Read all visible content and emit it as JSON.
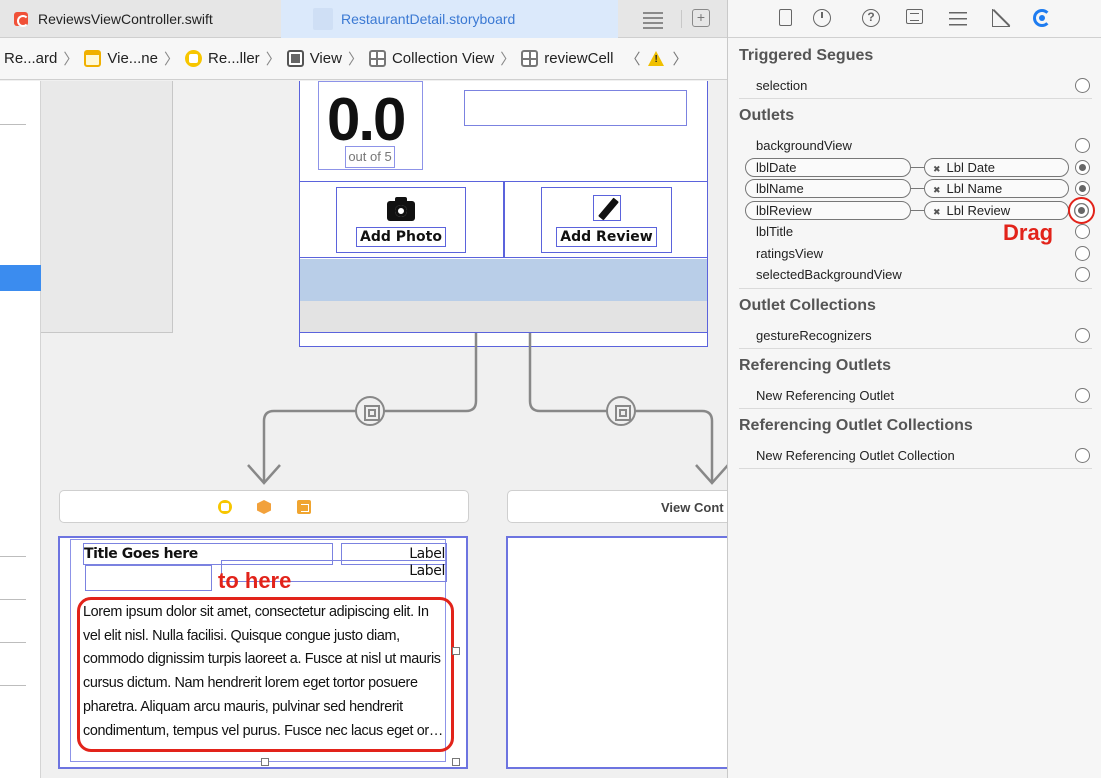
{
  "tabs": {
    "file1": "ReviewsViewController.swift",
    "file2": "RestaurantDetail.storyboard"
  },
  "breadcrumbs": [
    {
      "label": "Re...ard",
      "icon": "storyboard-icon"
    },
    {
      "label": "Vie...ne",
      "icon": "scene-icon"
    },
    {
      "label": "Re...ller",
      "icon": "view-controller-icon"
    },
    {
      "label": "View",
      "icon": "view-icon"
    },
    {
      "label": "Collection View",
      "icon": "collection-view-icon"
    },
    {
      "label": "reviewCell",
      "icon": "collection-view-cell-icon"
    }
  ],
  "canvas": {
    "rating_value": "0.0",
    "rating_caption": "out of 5",
    "add_photo_label": "Add Photo",
    "add_review_label": "Add Review",
    "scene_title_right": "View Cont",
    "review_cell": {
      "title": "Title Goes here",
      "label1": "Label",
      "label2": "Label",
      "review_lines": [
        "Lorem ipsum dolor sit amet, consectetur adipiscing elit. In",
        "vel elit nisl. Nulla facilisi. Quisque congue justo diam,",
        "commodo dignissim turpis laoreet a. Fusce at nisl ut mauris",
        "cursus dictum. Nam hendrerit lorem eget tortor posuere",
        "pharetra. Aliquam arcu mauris, pulvinar sed hendrerit",
        "condimentum, tempus vel purus. Fusce nec lacus eget or…"
      ]
    }
  },
  "annotations": {
    "to_here": "to here",
    "drag": "Drag"
  },
  "inspector": {
    "sections": {
      "triggered_segues": "Triggered Segues",
      "outlets": "Outlets",
      "outlet_collections": "Outlet Collections",
      "referencing_outlets": "Referencing Outlets",
      "referencing_outlet_collections": "Referencing Outlet Collections"
    },
    "triggered_segues": [
      {
        "name": "selection"
      }
    ],
    "outlets": [
      {
        "name": "backgroundView",
        "connected": false
      },
      {
        "name": "lblDate",
        "connected": true,
        "target": "Lbl Date"
      },
      {
        "name": "lblName",
        "connected": true,
        "target": "Lbl Name"
      },
      {
        "name": "lblReview",
        "connected": true,
        "target": "Lbl Review"
      },
      {
        "name": "lblTitle",
        "connected": false
      },
      {
        "name": "ratingsView",
        "connected": false
      },
      {
        "name": "selectedBackgroundView",
        "connected": false
      }
    ],
    "outlet_collections": [
      {
        "name": "gestureRecognizers"
      }
    ],
    "referencing_outlets": [
      {
        "name": "New Referencing Outlet"
      }
    ],
    "referencing_outlet_collections": [
      {
        "name": "New Referencing Outlet Collection"
      }
    ]
  },
  "colors": {
    "accent": "#3b79d3",
    "annotation_red": "#e2231a",
    "selection_blue": "#5b63dc"
  }
}
